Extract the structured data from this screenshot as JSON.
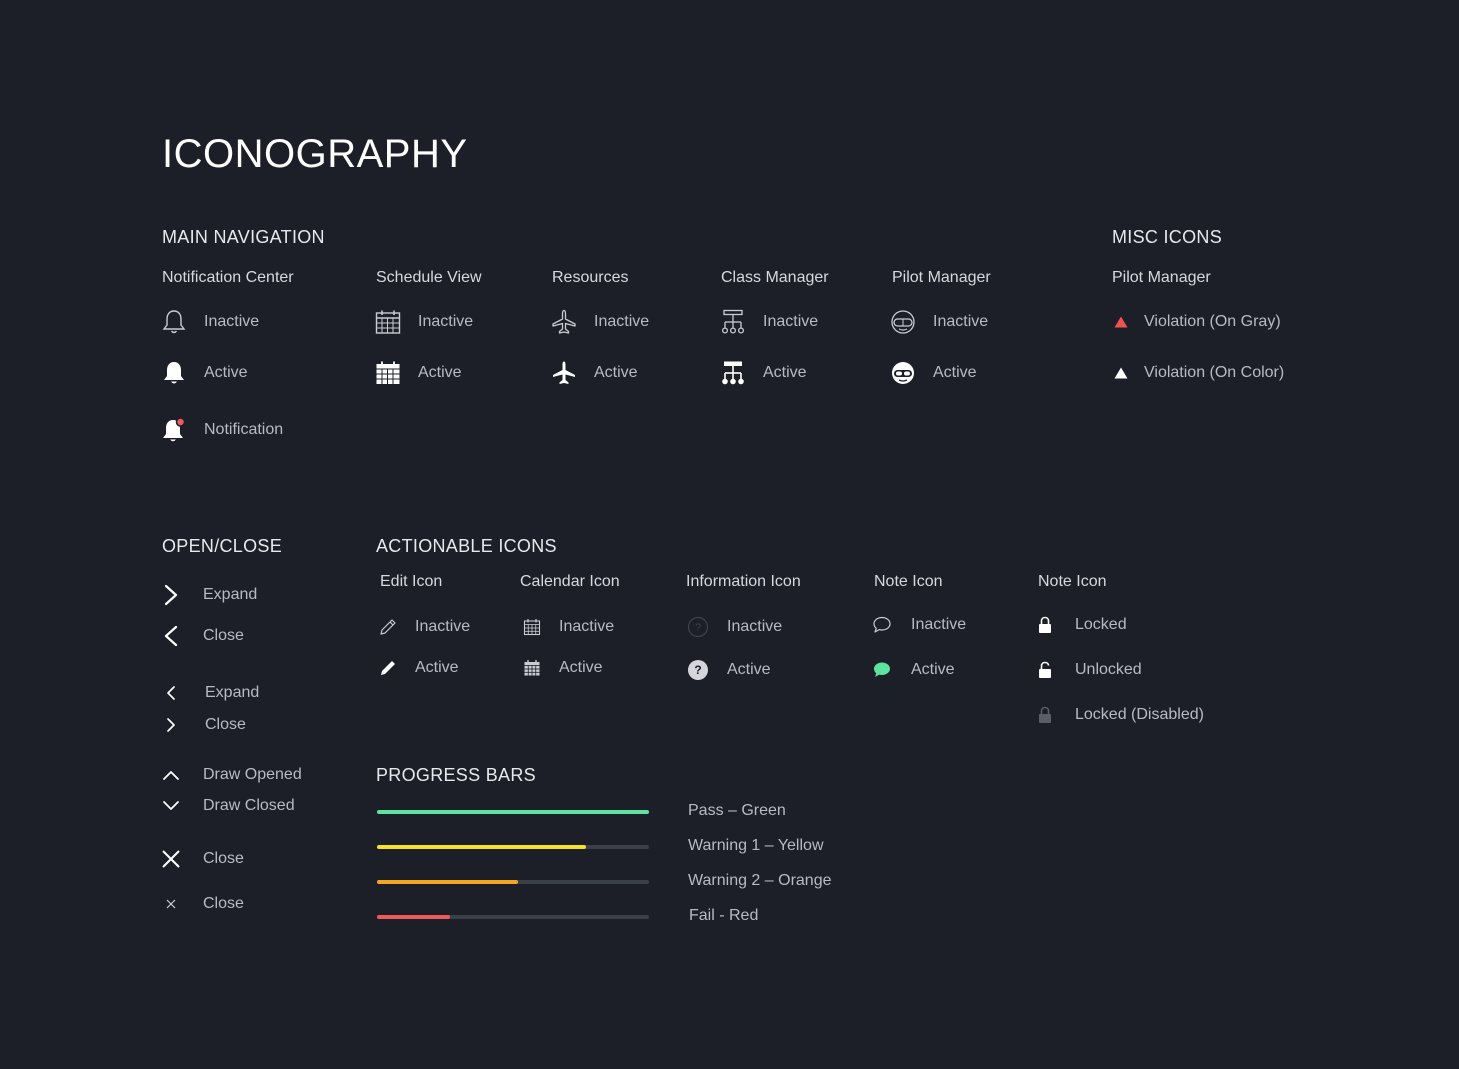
{
  "page_title": "ICONOGRAPHY",
  "main_nav": {
    "heading": "MAIN NAVIGATION",
    "columns": [
      {
        "title": "Notification Center",
        "items": [
          "Inactive",
          "Active",
          "Notification"
        ]
      },
      {
        "title": "Schedule View",
        "items": [
          "Inactive",
          "Active"
        ]
      },
      {
        "title": "Resources",
        "items": [
          "Inactive",
          "Active"
        ]
      },
      {
        "title": "Class Manager",
        "items": [
          "Inactive",
          "Active"
        ]
      },
      {
        "title": "Pilot Manager",
        "items": [
          "Inactive",
          "Active"
        ]
      }
    ]
  },
  "misc": {
    "heading": "MISC ICONS",
    "column_title": "Pilot Manager",
    "items": [
      "Violation (On Gray)",
      "Violation (On Color)"
    ]
  },
  "open_close": {
    "heading": "OPEN/CLOSE",
    "items": [
      "Expand",
      "Close",
      "Expand",
      "Close",
      "Draw Opened",
      "Draw Closed",
      "Close",
      "Close"
    ]
  },
  "actionable": {
    "heading": "ACTIONABLE ICONS",
    "columns": [
      {
        "title": "Edit Icon",
        "items": [
          "Inactive",
          "Active"
        ]
      },
      {
        "title": "Calendar Icon",
        "items": [
          "Inactive",
          "Active"
        ]
      },
      {
        "title": "Information Icon",
        "items": [
          "Inactive",
          "Active"
        ]
      },
      {
        "title": "Note Icon",
        "items": [
          "Inactive",
          "Active"
        ]
      },
      {
        "title": "Note Icon",
        "items": [
          "Locked",
          "Unlocked",
          "Locked (Disabled)"
        ]
      }
    ]
  },
  "progress": {
    "heading": "PROGRESS BARS",
    "bars": [
      {
        "label": "Pass – Green",
        "value": 1.0,
        "color": "#5ee2a0"
      },
      {
        "label": "Warning 1 – Yellow",
        "value": 0.77,
        "color": "#f7e22b"
      },
      {
        "label": "Warning 2 – Orange",
        "value": 0.52,
        "color": "#f5a524"
      },
      {
        "label": "Fail - Red",
        "value": 0.27,
        "color": "#ee5a5a"
      }
    ]
  },
  "colors": {
    "background": "#1c1f27",
    "icon_inactive": "#c9ccd3",
    "icon_active": "#ffffff",
    "violation_red": "#ef5350",
    "note_green": "#5ee2a0",
    "notification_dot": "#ee5a5a",
    "disabled": "#5a5e66"
  }
}
